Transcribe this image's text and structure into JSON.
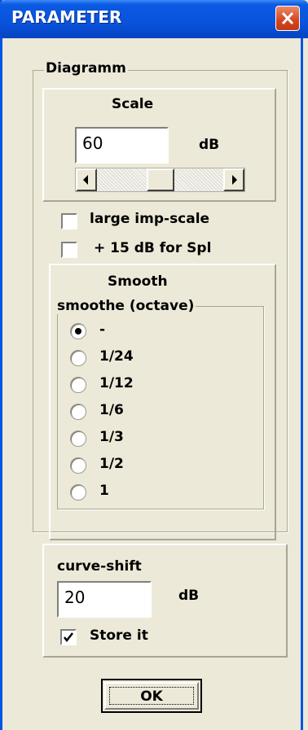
{
  "window": {
    "title": "PARAMETER"
  },
  "diagramm": {
    "legend": "Diagramm",
    "scale": {
      "title": "Scale",
      "value": "60",
      "unit": "dB"
    },
    "large_imp_scale": {
      "label": "large imp-scale",
      "checked": false
    },
    "plus15": {
      "label": "+ 15 dB for Spl",
      "checked": false
    },
    "smooth": {
      "title": "Smooth",
      "legend": "smoothe (octave)",
      "options": [
        "-",
        "1/24",
        "1/12",
        "1/6",
        "1/3",
        "1/2",
        "1"
      ],
      "selected": "-"
    }
  },
  "curve_shift": {
    "label": "curve-shift",
    "value": "20",
    "unit": "dB",
    "store_label": "Store it",
    "store_checked": true
  },
  "buttons": {
    "ok": "OK"
  }
}
